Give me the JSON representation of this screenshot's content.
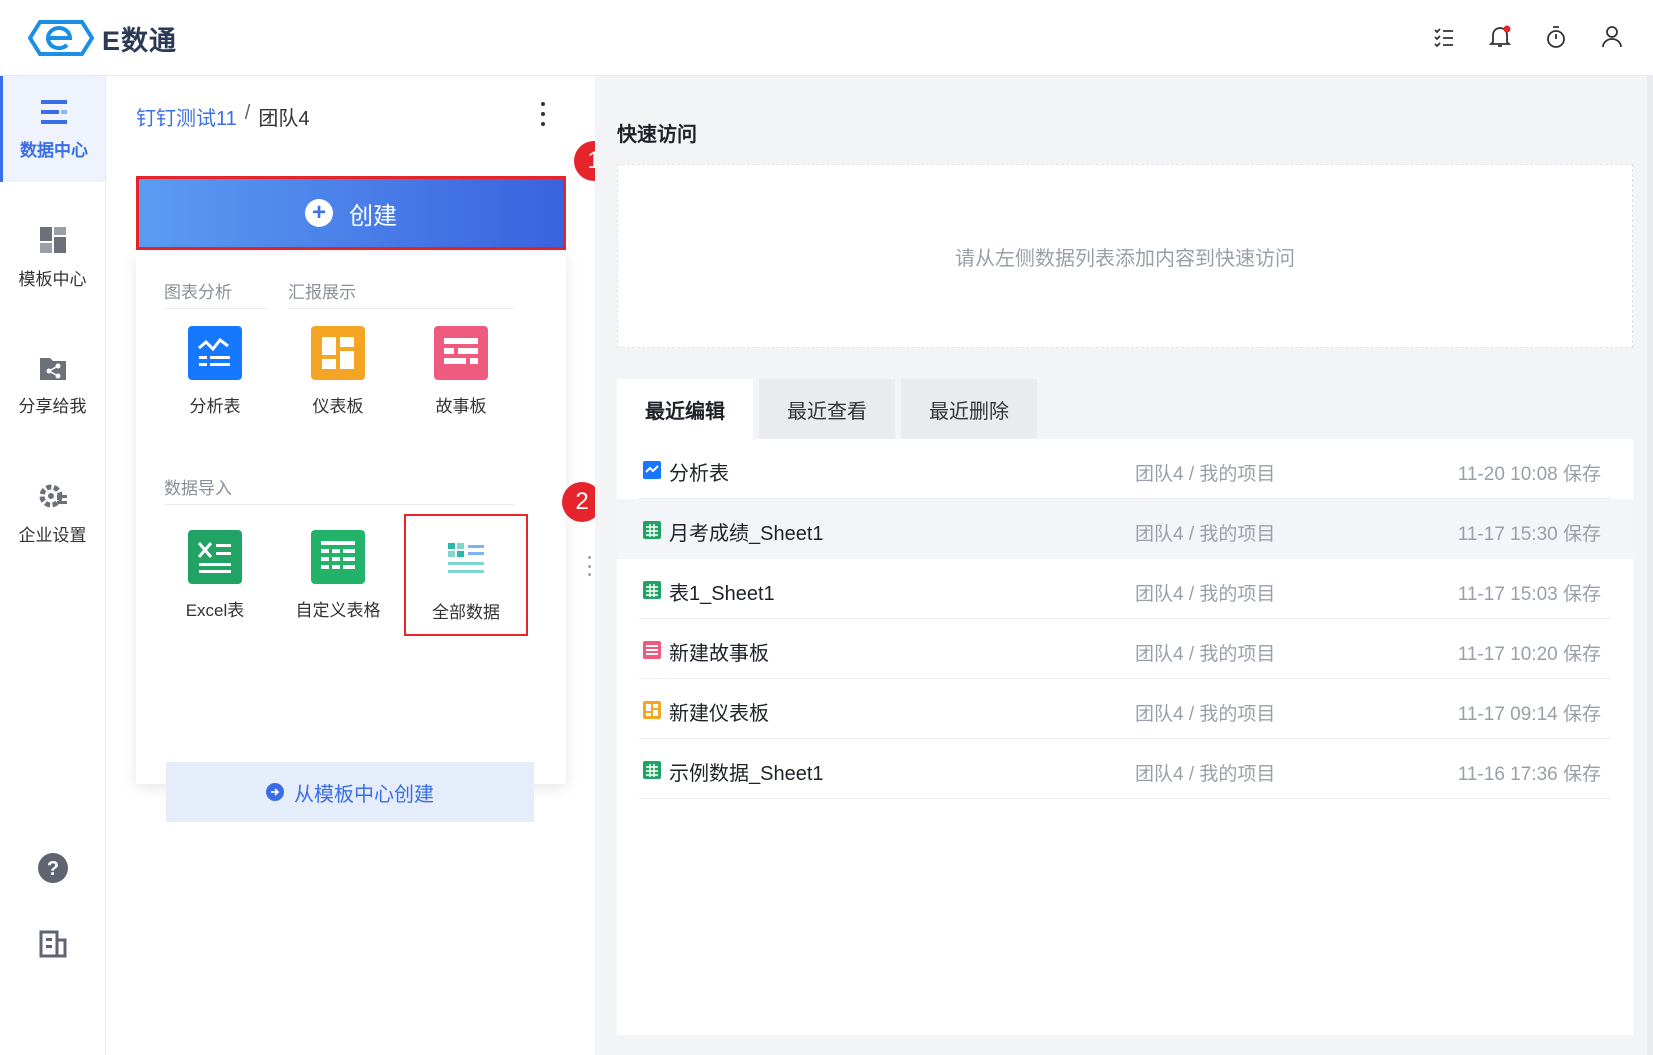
{
  "app": {
    "name": "E数通"
  },
  "topbar": {
    "icons": [
      "tasks-icon",
      "bell-icon",
      "timer-icon",
      "user-icon"
    ]
  },
  "nav": {
    "items": [
      {
        "label": "数据中心",
        "icon": "data-center-icon",
        "active": true
      },
      {
        "label": "模板中心",
        "icon": "template-icon",
        "active": false
      },
      {
        "label": "分享给我",
        "icon": "share-icon",
        "active": false
      },
      {
        "label": "企业设置",
        "icon": "settings-icon",
        "active": false
      }
    ],
    "bottom": [
      "help-icon",
      "building-icon"
    ]
  },
  "breadcrumb": {
    "parent": "钉钉测试11",
    "separator": "/",
    "current": "团队4"
  },
  "create": {
    "label": "创建",
    "section_analysis": "图表分析",
    "section_report": "汇报展示",
    "section_import": "数据导入",
    "tiles_top": [
      {
        "label": "分析表",
        "color": "#1677ff"
      },
      {
        "label": "仪表板",
        "color": "#f5a524"
      },
      {
        "label": "故事板",
        "color": "#ef5b7e"
      }
    ],
    "tiles_import": [
      {
        "label": "Excel表",
        "color": "#21a366"
      },
      {
        "label": "自定义表格",
        "color": "#22b269"
      },
      {
        "label": "全部数据",
        "color": "#2bb8a8"
      }
    ],
    "template_label": "从模板中心创建"
  },
  "badges": {
    "one": "1",
    "two": "2"
  },
  "quick_access": {
    "title": "快速访问",
    "empty": "请从左侧数据列表添加内容到快速访问"
  },
  "tabs": [
    "最近编辑",
    "最近查看",
    "最近删除"
  ],
  "recent": [
    {
      "name": "分析表",
      "type": "analysis",
      "location": "团队4 / 我的项目",
      "time": "11-20 10:08 保存"
    },
    {
      "name": "月考成绩_Sheet1",
      "type": "sheet",
      "location": "团队4 / 我的项目",
      "time": "11-17 15:30 保存"
    },
    {
      "name": "表1_Sheet1",
      "type": "sheet",
      "location": "团队4 / 我的项目",
      "time": "11-17 15:03 保存"
    },
    {
      "name": "新建故事板",
      "type": "story",
      "location": "团队4 / 我的项目",
      "time": "11-17 10:20 保存"
    },
    {
      "name": "新建仪表板",
      "type": "dashboard",
      "location": "团队4 / 我的项目",
      "time": "11-17 09:14 保存"
    },
    {
      "name": "示例数据_Sheet1",
      "type": "sheet",
      "location": "团队4 / 我的项目",
      "time": "11-16 17:36 保存"
    }
  ],
  "colors": {
    "accent": "#3a6ee8",
    "highlight": "#e5242b"
  }
}
